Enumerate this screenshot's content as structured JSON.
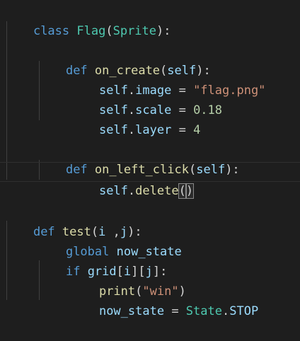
{
  "editor": {
    "lines": {
      "l1": {
        "kw": "class",
        "name": "Flag",
        "open": "(",
        "base": "Sprite",
        "close": "):"
      },
      "l3": {
        "kw": "def",
        "name": "on_create",
        "open": "(",
        "param": "self",
        "close": "):"
      },
      "l4": {
        "obj": "self",
        "dot": ".",
        "attr": "image",
        "eq": " = ",
        "val": "\"flag.png\""
      },
      "l5": {
        "obj": "self",
        "dot": ".",
        "attr": "scale",
        "eq": " = ",
        "val": "0.18"
      },
      "l6": {
        "obj": "self",
        "dot": ".",
        "attr": "layer",
        "eq": " = ",
        "val": "4"
      },
      "l8": {
        "kw": "def",
        "name": "on_left_click",
        "open": "(",
        "param": "self",
        "close": "):"
      },
      "l9": {
        "obj": "self",
        "dot": ".",
        "method": "delete",
        "open": "(",
        "close": ")"
      },
      "l11": {
        "kw": "def",
        "name": "test",
        "open": "(",
        "p1": "i",
        "sep": " ,",
        "p2": "j",
        "close": "):"
      },
      "l12": {
        "kw": "global",
        "var": "now_state"
      },
      "l13": {
        "kw": "if",
        "name": "grid",
        "b1": "[",
        "i": "i",
        "b2": "][",
        "j": "j",
        "b3": "]:"
      },
      "l14": {
        "name": "print",
        "open": "(",
        "str": "\"win\"",
        "close": ")"
      },
      "l15": {
        "var": "now_state",
        "eq": " = ",
        "cls": "State",
        "dot": ".",
        "member": "STOP"
      }
    }
  }
}
